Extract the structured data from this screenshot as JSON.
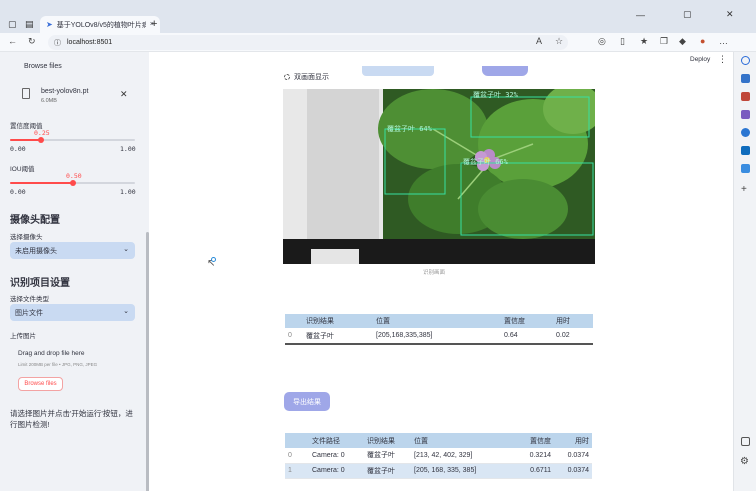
{
  "browser": {
    "tab_title": "基于YOLOv8/v5的植物叶片病害识别",
    "url": "localhost:8501",
    "tab_close": "×",
    "new_tab": "+",
    "back": "←",
    "reload": "↻",
    "info": "ⓘ"
  },
  "app": {
    "deploy_label": "Deploy",
    "menu_glyph": "⋮"
  },
  "sidebar": {
    "browse_top": "Browse files",
    "file": {
      "name": "best-yolov8n.pt",
      "size": "6.0MB",
      "close": "✕"
    },
    "conf": {
      "label": "置信度阈值",
      "value": "0.25",
      "min": "0.00",
      "max": "1.00",
      "fraction": 0.25
    },
    "iou": {
      "label": "IOU阈值",
      "value": "0.50",
      "min": "0.00",
      "max": "1.00",
      "fraction": 0.5
    },
    "camera_section": "摄像头配置",
    "camera_select_label": "选择摄像头",
    "camera_select_value": "未启用摄像头",
    "recog_section": "识别项目设置",
    "filetype_label": "选择文件类型",
    "filetype_value": "图片文件",
    "upload_label": "上传图片",
    "drop_text": "Drag and drop file here",
    "drop_sub": "Limit 200MB per file • JPG, PNG, JPEG",
    "browse_button": "Browse files",
    "note": "请选择图片并点击'开始运行'按钮，进行图片检测!",
    "arrow": "⌄"
  },
  "main": {
    "dual_display": "双画面显示",
    "image_caption": "识别画面",
    "export_button": "导出结果",
    "detections": [
      {
        "label": "覆盆子叶 64%"
      },
      {
        "label": "覆盆子叶 32%"
      },
      {
        "label": "覆盆子叶 66%"
      }
    ],
    "table1": {
      "headers": [
        "",
        "识别结果",
        "位置",
        "置信度",
        "用时"
      ],
      "rows": [
        [
          "0",
          "覆盆子叶",
          "[205,168,335,385]",
          "0.64",
          "0.02"
        ]
      ]
    },
    "table2": {
      "headers": [
        "",
        "文件路径",
        "识别结果",
        "位置",
        "置信度",
        "用时"
      ],
      "rows": [
        [
          "0",
          "Camera: 0",
          "覆盆子叶",
          "[213, 42, 402, 329]",
          "0.3214",
          "0.0374"
        ],
        [
          "1",
          "Camera: 0",
          "覆盆子叶",
          "[205, 168, 335, 385]",
          "0.6711",
          "0.0374"
        ]
      ]
    }
  },
  "colors": {
    "accent": "#ff4b4b",
    "select_bg": "#c9daf2",
    "button_bg": "#9fa7e8",
    "table_header": "#bcd5ec",
    "sidebar_bg": "#f0f2f6"
  }
}
